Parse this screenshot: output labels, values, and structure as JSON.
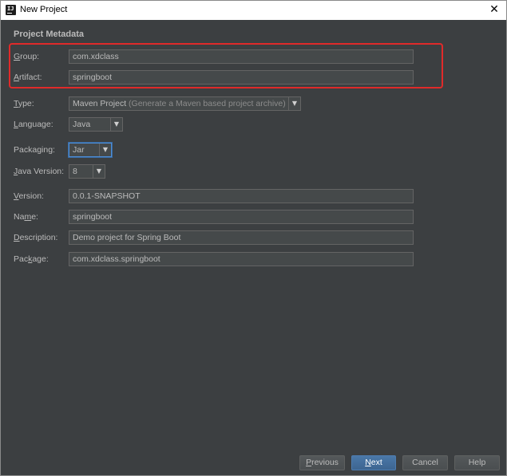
{
  "window": {
    "title": "New Project",
    "app_icon_text": "IJ",
    "close_glyph": "✕"
  },
  "section_title": "Project Metadata",
  "form": {
    "group": {
      "label_u": "G",
      "label_rest": "roup:",
      "value": "com.xdclass"
    },
    "artifact": {
      "label_u": "A",
      "label_rest": "rtifact:",
      "value": "springboot"
    },
    "type": {
      "label_u": "T",
      "label_rest": "ype:",
      "value": "Maven Project",
      "hint": "(Generate a Maven based project archive)"
    },
    "language": {
      "label_u": "L",
      "label_rest": "anguage:",
      "value": "Java"
    },
    "packaging": {
      "label_pre": "Packa",
      "label_u": "g",
      "label_rest": "ing:",
      "value": "Jar"
    },
    "java_version": {
      "label_u": "J",
      "label_rest": "ava Version:",
      "value": "8"
    },
    "version": {
      "label_u": "V",
      "label_rest": "ersion:",
      "value": "0.0.1-SNAPSHOT"
    },
    "name": {
      "label_pre": "Na",
      "label_u": "m",
      "label_rest": "e:",
      "value": "springboot"
    },
    "description": {
      "label_u": "D",
      "label_rest": "escription:",
      "value": "Demo project for Spring Boot"
    },
    "package": {
      "label_pre": "Pac",
      "label_u": "k",
      "label_rest": "age:",
      "value": "com.xdclass.springboot"
    }
  },
  "dropdown_arrow": "▼",
  "buttons": {
    "previous": {
      "label_u": "P",
      "label_rest": "revious"
    },
    "next": {
      "label_u": "N",
      "label_rest": "ext"
    },
    "cancel": "Cancel",
    "help": "Help"
  },
  "colors": {
    "background": "#3c3f41",
    "field_bg": "#45494a",
    "text": "#bbbbbb",
    "highlight_box": "#e02a2a",
    "default_button": "#3d6591"
  }
}
